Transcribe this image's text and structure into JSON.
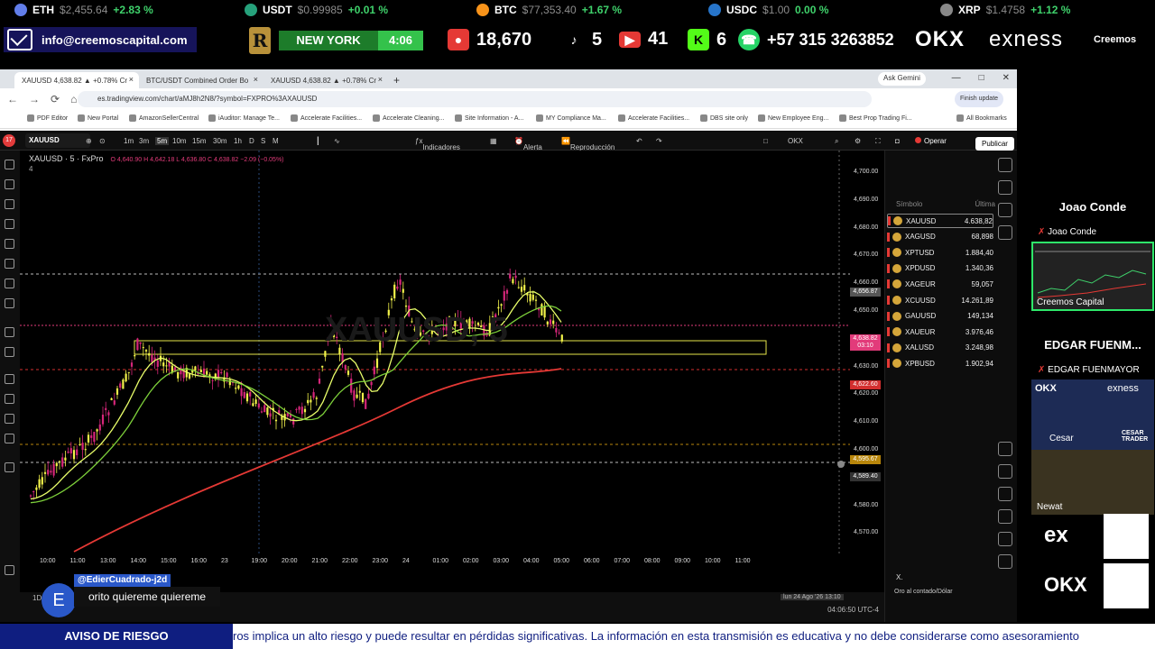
{
  "ticker": [
    {
      "sym": "ETH",
      "price": "$2,455.64",
      "chg": "+2.83 %",
      "color": "#627eea"
    },
    {
      "sym": "USDT",
      "price": "$0.99985",
      "chg": "+0.01 %",
      "color": "#26a17b"
    },
    {
      "sym": "BTC",
      "price": "$77,353.40",
      "chg": "+1.67 %",
      "color": "#f7931a"
    },
    {
      "sym": "USDC",
      "price": "$1.00",
      "chg": "0.00 %",
      "color": "#2775ca"
    },
    {
      "sym": "XRP",
      "price": "$1.4758",
      "chg": "+1.12 %",
      "color": "#888888"
    }
  ],
  "banner": {
    "email": "info@creemoscapital.com",
    "city": "NEW YORK",
    "time": "4:06",
    "followers": "18,670",
    "tiktok": "5",
    "youtube": "41",
    "kick": "6",
    "whatsapp": "+57 315 3263852",
    "okx": "OKX",
    "exness": "exness",
    "creemos": "Creemos"
  },
  "browser": {
    "tabs": [
      "XAUUSD 4,638.82 ▲ +0.78% Cr",
      "BTC/USDT Combined Order Bo",
      "XAUUSD 4,638.82 ▲ +0.78% Cr"
    ],
    "gemini": "Ask Gemini",
    "url": "es.tradingview.com/chart/aMJ8h2N8/?symbol=FXPRO%3AXAUUSD",
    "finish": "Finish update",
    "bookmarks": [
      "PDF Editor",
      "New Portal",
      "AmazonSellerCentral",
      "iAuditor: Manage Te...",
      "Accelerate Facilities...",
      "Accelerate Cleaning...",
      "Site Information - A...",
      "MY Compliance Ma...",
      "Accelerate Facilities...",
      "DBS site only",
      "New Employee Eng...",
      "Best Prop Trading Fi..."
    ],
    "all_bookmarks": "All Bookmarks"
  },
  "tv": {
    "avatar": "17",
    "symbol": "XAUUSD",
    "intervals": [
      "1m",
      "3m",
      "5m",
      "10m",
      "15m",
      "30m",
      "1h",
      "D",
      "S",
      "M"
    ],
    "indicadores": "Indicadores",
    "alerta": "Alerta",
    "reproduccion": "Reproducción",
    "broker": "OKX",
    "operar": "Operar",
    "publicar": "Publicar",
    "legend": "XAUUSD · 5 · FxPro",
    "legend_ohlc": "O 4,640.90  H 4,642.18  L 4,636.80  C 4,638.82  −2.09 (−0.05%)",
    "legend_sub": "4",
    "watermark": "XAUUSD, 5",
    "timezone": "04:06:50 UTC-4",
    "cursor_date": "lun 24 Ago '26",
    "cursor_time": "13:10",
    "bottom_left": "1D",
    "watchlist_head": [
      "Símbolo",
      "Última"
    ],
    "watchlist": [
      {
        "s": "XAUUSD",
        "p": "4.638,82"
      },
      {
        "s": "XAGUSD",
        "p": "68,898"
      },
      {
        "s": "XPTUSD",
        "p": "1.884,40"
      },
      {
        "s": "XPDUSD",
        "p": "1.340,36"
      },
      {
        "s": "XAGEUR",
        "p": "59,057"
      },
      {
        "s": "XCUUSD",
        "p": "14.261,89"
      },
      {
        "s": "GAUUSD",
        "p": "149,134"
      },
      {
        "s": "XAUEUR",
        "p": "3.976,46"
      },
      {
        "s": "XALUSD",
        "p": "3.248,98"
      },
      {
        "s": "XPBUSD",
        "p": "1.902,94"
      }
    ],
    "panel_bottom": "Oro al contado/Dólar",
    "panel_bottom_sym": "X.",
    "price_axis": [
      "4,700.00",
      "4,690.00",
      "4,680.00",
      "4,670.00",
      "4,660.00",
      "4,650.00",
      "4,640.00",
      "4,630.00",
      "4,620.00",
      "4,610.00",
      "4,600.00",
      "4,590.00",
      "4,580.00",
      "4,570.00"
    ],
    "price_tags": [
      {
        "v": "4,656.87",
        "color": "#555555"
      },
      {
        "v": "4,638.82",
        "color": "#e23b7a"
      },
      {
        "v": "03:10",
        "color": "#e23b7a"
      },
      {
        "v": "4,622.60",
        "color": "#d32f2f"
      },
      {
        "v": "4,595.67",
        "color": "#b8860b"
      },
      {
        "v": "4,589.40",
        "color": "#333333"
      }
    ],
    "time_axis": [
      "10:00",
      "11:00",
      "13:00",
      "14:00",
      "15:00",
      "16:00",
      "23",
      "19:00",
      "20:00",
      "21:00",
      "22:00",
      "23:00",
      "24",
      "01:00",
      "02:00",
      "03:00",
      "04:00",
      "05:00",
      "06:00",
      "07:00",
      "08:00",
      "09:00",
      "10:00",
      "11:00"
    ]
  },
  "chat": {
    "avatar": "E",
    "user": "@EdierCuadrado-j2d",
    "message": "orito quiereme quiereme"
  },
  "cams": {
    "cam1_title": "Joao Conde",
    "cam1_label": "Joao Conde",
    "cam1_sub": "Creemos Capital",
    "cam2_title": "EDGAR FUENM...",
    "cam2_label": "EDGAR FUENMAYOR",
    "cam2_okx": "OKX",
    "cam2_exness": "exness",
    "cam2_cesar": "Cesar",
    "cam2_newat": "Newat",
    "cam2_sign": "CESAR TRADER",
    "ex": "ex",
    "okx": "OKX"
  },
  "risk": {
    "label": "AVISO DE RIESGO",
    "text": "ros implica un alto riesgo y puede resultar en pérdidas significativas. La información en esta transmisión es educativa y no debe considerarse como asesoramiento"
  }
}
